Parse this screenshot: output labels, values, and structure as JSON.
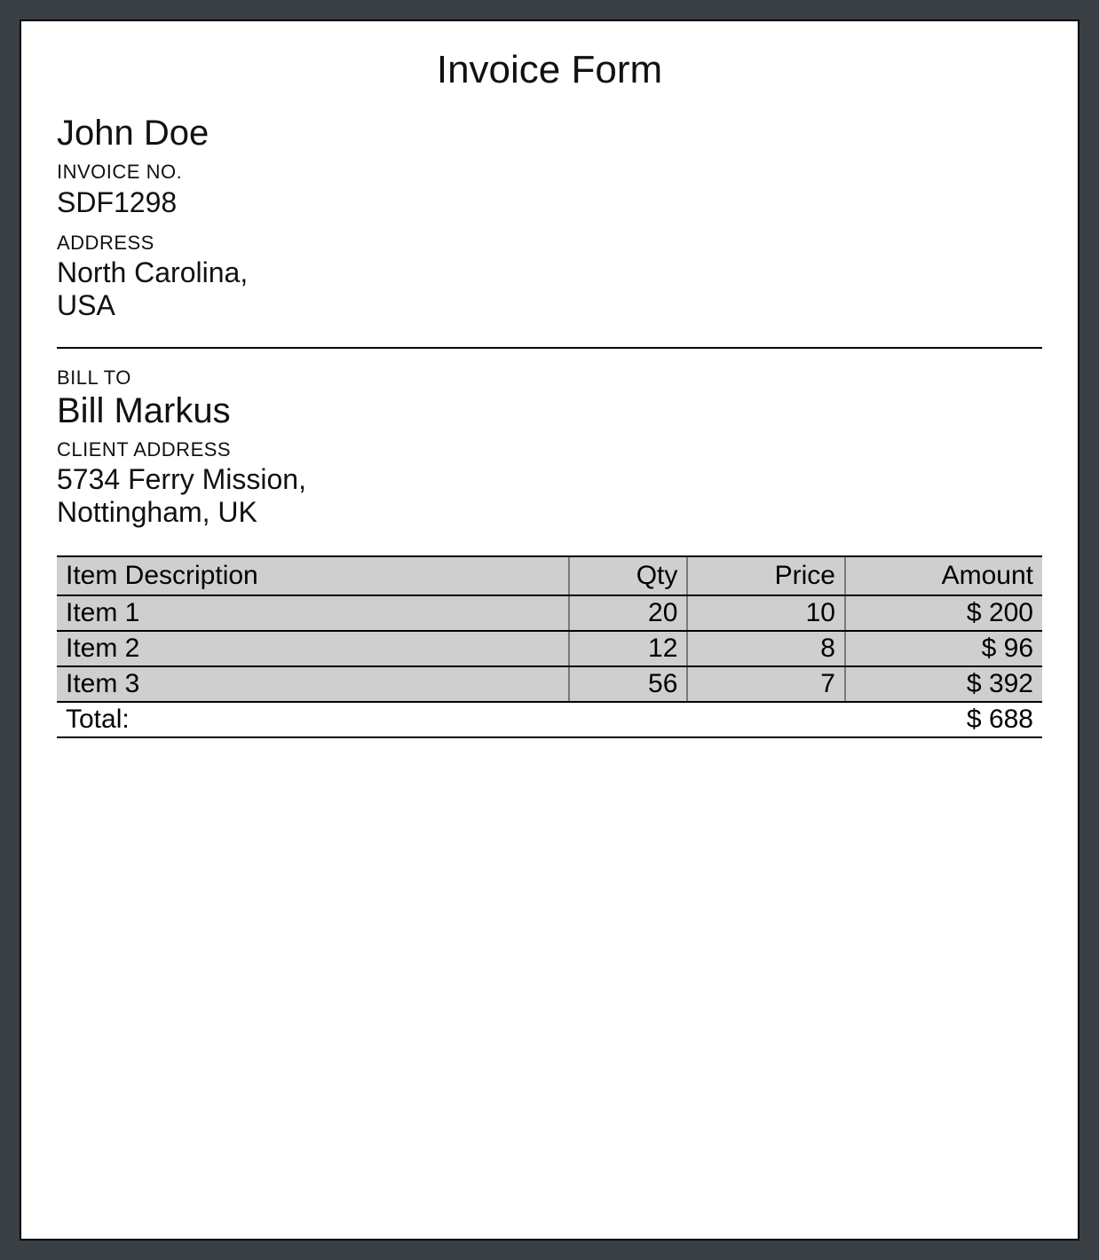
{
  "title": "Invoice Form",
  "sender": {
    "name": "John Doe",
    "invoice_no_label": "INVOICE NO.",
    "invoice_no": "SDF1298",
    "address_label": "ADDRESS",
    "address_line1": "North Carolina,",
    "address_line2": "USA"
  },
  "bill_to": {
    "label": "BILL TO",
    "name": "Bill Markus",
    "client_address_label": "CLIENT ADDRESS",
    "address_line1": "5734 Ferry Mission,",
    "address_line2": "Nottingham, UK"
  },
  "table": {
    "headers": {
      "description": "Item Description",
      "qty": "Qty",
      "price": "Price",
      "amount": "Amount"
    },
    "rows": [
      {
        "description": "Item 1",
        "qty": "20",
        "price": "10",
        "amount": "$ 200"
      },
      {
        "description": "Item 2",
        "qty": "12",
        "price": "8",
        "amount": "$ 96"
      },
      {
        "description": "Item 3",
        "qty": "56",
        "price": "7",
        "amount": "$ 392"
      }
    ],
    "total_label": "Total:",
    "total_amount": "$ 688"
  }
}
